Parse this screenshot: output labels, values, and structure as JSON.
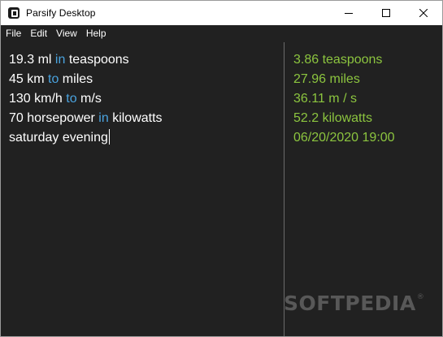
{
  "window": {
    "title": "Parsify Desktop",
    "icon": "parsify-logo-icon",
    "controls": [
      "minimize-icon",
      "maximize-icon",
      "close-icon"
    ]
  },
  "menu": {
    "file": "File",
    "edit": "Edit",
    "view": "View",
    "help": "Help"
  },
  "editor": {
    "lines": [
      {
        "before": "19.3 ml ",
        "keyword": "in",
        "after": " teaspoons"
      },
      {
        "before": "45 km ",
        "keyword": "to",
        "after": " miles"
      },
      {
        "before": "130 km/h ",
        "keyword": "to",
        "after": " m/s"
      },
      {
        "before": "70 horsepower ",
        "keyword": "in",
        "after": " kilowatts"
      },
      {
        "before": "saturday evening",
        "keyword": "",
        "after": ""
      }
    ]
  },
  "results": [
    "3.86 teaspoons",
    "27.96 miles",
    "36.11 m / s",
    "52.2 kilowatts",
    "06/20/2020 19:00"
  ],
  "watermark": {
    "text": "SOFTPEDIA",
    "mark": "®"
  },
  "colors": {
    "background": "#212121",
    "text": "#ffffff",
    "keyword": "#4aa3df",
    "result": "#8cc53f",
    "divider": "#6b6b6b"
  }
}
